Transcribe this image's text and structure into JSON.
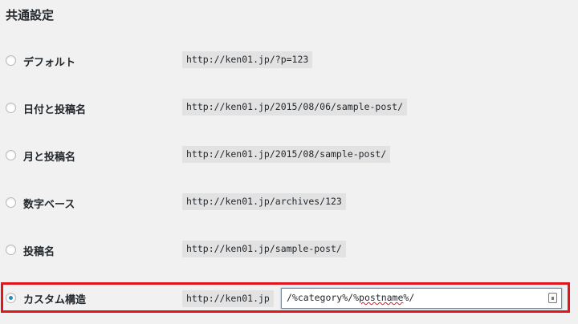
{
  "section": {
    "title": "共通設定"
  },
  "options": [
    {
      "label": "デフォルト",
      "example": "http://ken01.jp/?p=123",
      "checked": false
    },
    {
      "label": "日付と投稿名",
      "example": "http://ken01.jp/2015/08/06/sample-post/",
      "checked": false
    },
    {
      "label": "月と投稿名",
      "example": "http://ken01.jp/2015/08/sample-post/",
      "checked": false
    },
    {
      "label": "数字ベース",
      "example": "http://ken01.jp/archives/123",
      "checked": false
    },
    {
      "label": "投稿名",
      "example": "http://ken01.jp/sample-post/",
      "checked": false
    }
  ],
  "custom": {
    "label": "カスタム構造",
    "base": "http://ken01.jp",
    "value_prefix": "/%category%/%",
    "value_spell": "postname",
    "value_suffix": "%/",
    "checked": true,
    "highlight_color": "#e0161f",
    "input_icon": "keeper-lock-icon"
  }
}
